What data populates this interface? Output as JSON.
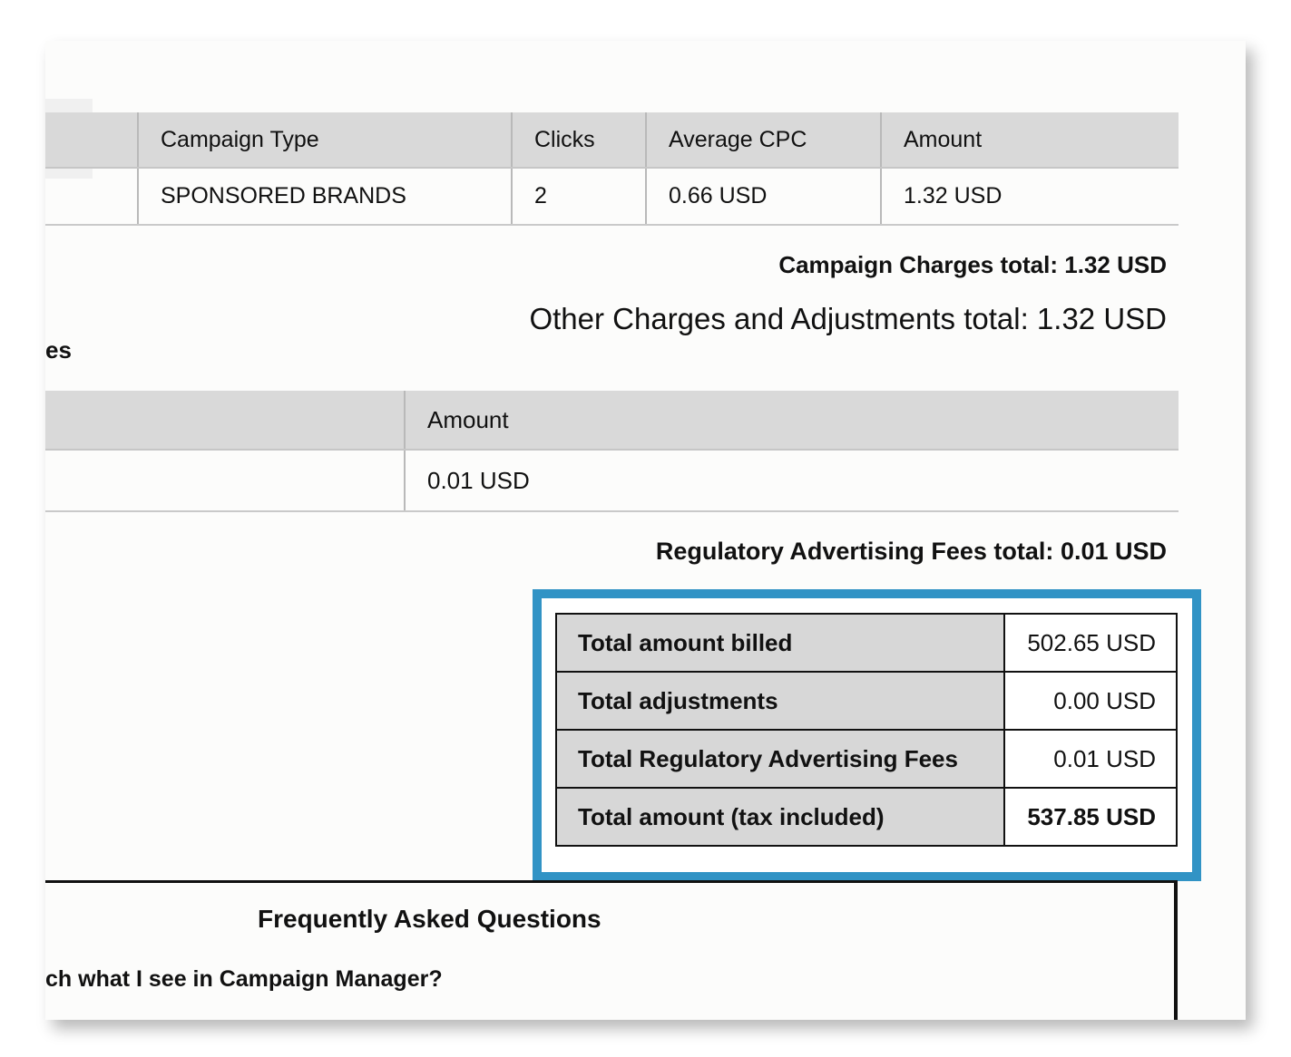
{
  "campaign_table": {
    "headers": [
      "",
      "Campaign Type",
      "Clicks",
      "Average CPC",
      "Amount"
    ],
    "rows": [
      [
        "",
        "SPONSORED BRANDS",
        "2",
        "0.66 USD",
        "1.32 USD"
      ]
    ]
  },
  "campaign_charges_total": {
    "label": "Campaign Charges total:",
    "value": "1.32 USD"
  },
  "other_charges_total": "Other Charges and Adjustments total: 1.32 USD",
  "section_fragment": "es",
  "fees_table": {
    "headers": [
      "",
      "Amount"
    ],
    "rows": [
      [
        "",
        "0.01 USD"
      ]
    ]
  },
  "regulatory_fees_total": {
    "label": "Regulatory Advertising Fees total:",
    "value": "0.01 USD"
  },
  "summary": {
    "highlight_color": "#3193c5",
    "rows": [
      {
        "label": "Total amount billed",
        "value": "502.65 USD"
      },
      {
        "label": "Total adjustments",
        "value": "0.00 USD"
      },
      {
        "label": "Total Regulatory Advertising Fees",
        "value": "0.01 USD"
      },
      {
        "label": "Total amount (tax included)",
        "value": "537.85 USD"
      }
    ]
  },
  "faq": {
    "title": "Frequently Asked Questions",
    "question_fragment": "ch what I see in Campaign Manager?"
  }
}
